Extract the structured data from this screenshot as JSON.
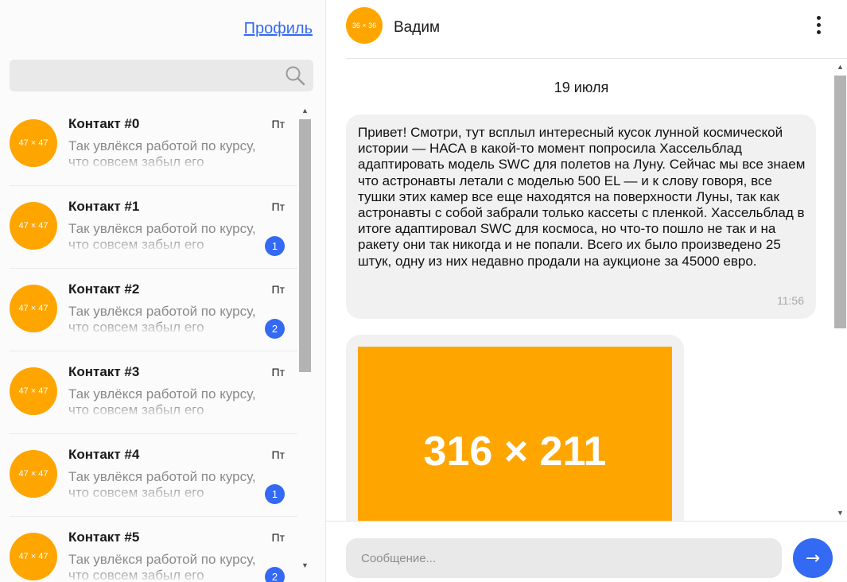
{
  "sidebar": {
    "profile_link": "Профиль",
    "search": {
      "icon": "search-icon",
      "placeholder": ""
    },
    "contacts": [
      {
        "avatar": "47 × 47",
        "name": "Контакт #0",
        "time": "Пт",
        "preview": "Так увлёкся работой по курсу, что совсем забыл его",
        "unread": ""
      },
      {
        "avatar": "47 × 47",
        "name": "Контакт #1",
        "time": "Пт",
        "preview": "Так увлёкся работой по курсу, что совсем забыл его",
        "unread": "1"
      },
      {
        "avatar": "47 × 47",
        "name": "Контакт #2",
        "time": "Пт",
        "preview": "Так увлёкся работой по курсу, что совсем забыл его",
        "unread": "2"
      },
      {
        "avatar": "47 × 47",
        "name": "Контакт #3",
        "time": "Пт",
        "preview": "Так увлёкся работой по курсу, что совсем забыл его",
        "unread": ""
      },
      {
        "avatar": "47 × 47",
        "name": "Контакт #4",
        "time": "Пт",
        "preview": "Так увлёкся работой по курсу, что совсем забыл его",
        "unread": "1"
      },
      {
        "avatar": "47 × 47",
        "name": "Контакт #5",
        "time": "Пт",
        "preview": "Так увлёкся работой по курсу, что совсем забыл его",
        "unread": "2"
      }
    ]
  },
  "chat": {
    "header": {
      "avatar": "36 × 36",
      "name": "Вадим",
      "menu_icon": "more-vertical-icon"
    },
    "date": "19 июля",
    "messages": [
      {
        "text": "Привет! Смотри, тут всплыл интересный кусок лунной космической истории — НАСА в какой-то момент попросила Хассельблад адаптировать модель SWC для полетов на Луну. Сейчас мы все знаем что астронавты летали с моделью 500 EL — и к слову говоря, все тушки этих камер все еще находятся на поверхности Луны, так как астронавты с собой забрали только кассеты с пленкой. Хассельблад в итоге адаптировал SWC для космоса, но что-то пошло не так и на ракету они так никогда и не попали. Всего их было произведено 25 штук, одну из них недавно продали на аукционе за 45000 евро.",
        "time": "11:56"
      },
      {
        "image": "316 × 211"
      }
    ],
    "composer": {
      "placeholder": "Сообщение...",
      "value": "",
      "send_label": "→"
    }
  },
  "colors": {
    "accent": "#3369f3",
    "placeholder_avatar": "#ffa500",
    "bubble": "#f1f1f1",
    "input": "#e9e9e9"
  }
}
